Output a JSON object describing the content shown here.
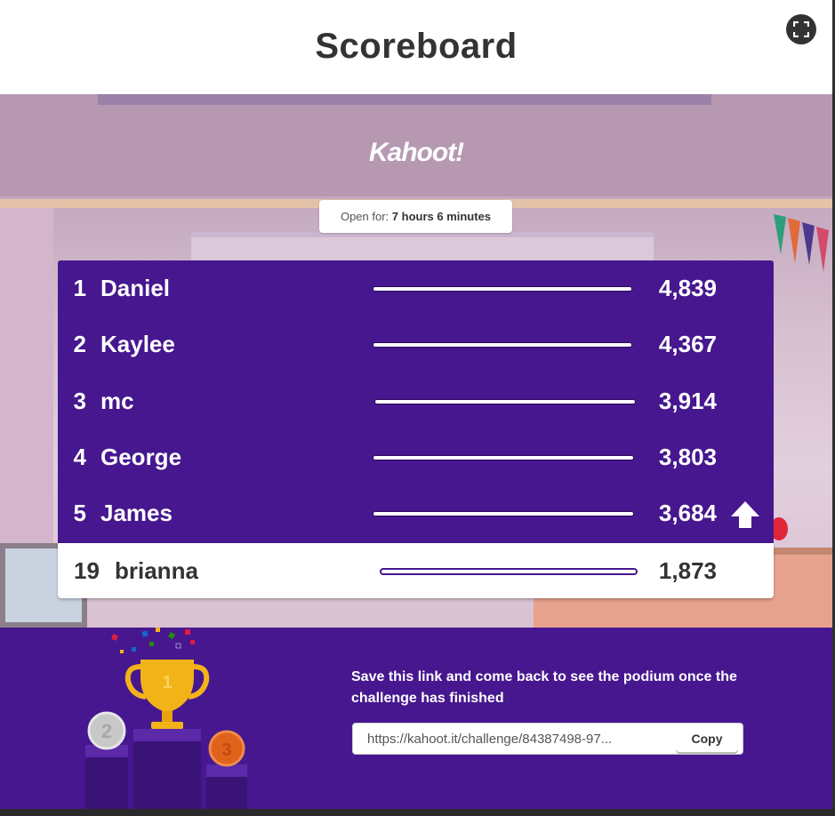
{
  "header": {
    "title": "Scoreboard",
    "fullscreen_icon": "fullscreen-icon"
  },
  "logo": {
    "text": "Kahoot!"
  },
  "open_for": {
    "label": "Open for: ",
    "value": "7 hours 6 minutes"
  },
  "leaderboard": [
    {
      "rank": "1",
      "name": "Daniel",
      "score": "4,839",
      "progress": 1.0
    },
    {
      "rank": "2",
      "name": "Kaylee",
      "score": "4,367",
      "progress": 1.0
    },
    {
      "rank": "3",
      "name": "mc",
      "score": "3,914",
      "progress": 1.0
    },
    {
      "rank": "4",
      "name": "George",
      "score": "3,803",
      "progress": 1.0
    },
    {
      "rank": "5",
      "name": "James",
      "score": "3,684",
      "progress": 1.0,
      "trend_icon": "up-arrow-icon"
    }
  ],
  "current_player": {
    "rank": "19",
    "name": "brianna",
    "score": "1,873"
  },
  "footer": {
    "save_text": "Save this link and come back to see the podium once the challenge has finished",
    "link": "https://kahoot.it/challenge/84387498-97...",
    "copy_label": "Copy",
    "podium_labels": [
      "2",
      "1",
      "3"
    ]
  },
  "colors": {
    "purple": "#46178f",
    "gold": "#f2b319",
    "silver": "#c8c8c8",
    "bronze": "#e0631c"
  }
}
